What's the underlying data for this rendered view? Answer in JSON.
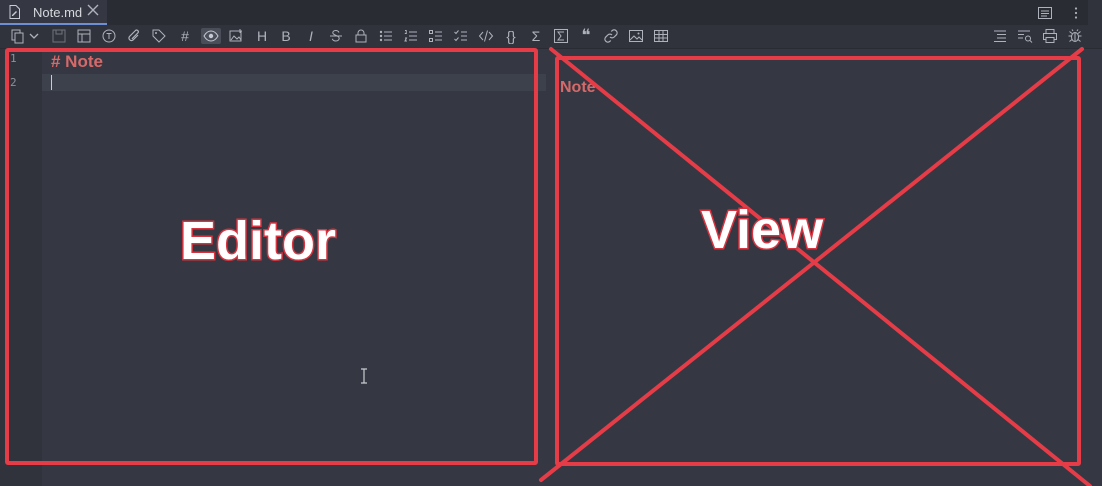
{
  "tab": {
    "label": "Note.md"
  },
  "toolbar": {
    "heading_glyph": "H",
    "bold_glyph": "B",
    "italic_glyph": "I",
    "hash_glyph": "#",
    "braces_glyph": "{}",
    "sigma_glyph": "Σ",
    "quote_glyph": "❝"
  },
  "editor": {
    "line_numbers": [
      "1",
      "2"
    ],
    "line1": "# Note"
  },
  "view": {
    "title": "Note"
  },
  "annotations": {
    "editor_label": "Editor",
    "view_label": "View"
  },
  "colors": {
    "annotation": "#e53c48",
    "heading": "#d66a6a",
    "background": "#353842"
  }
}
